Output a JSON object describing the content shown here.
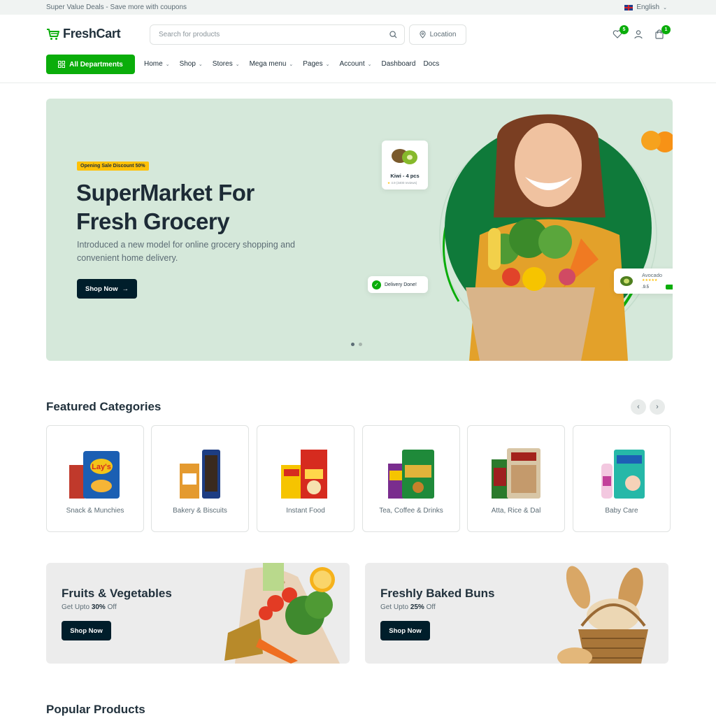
{
  "topbar": {
    "promo": "Super Value Deals - Save more with coupons",
    "language": "English"
  },
  "header": {
    "logo": "FreshCart",
    "search_placeholder": "Search for products",
    "location_label": "Location",
    "wishlist_count": "5",
    "cart_count": "1"
  },
  "nav": {
    "departments_label": "All Departments",
    "items": [
      {
        "label": "Home",
        "dropdown": true
      },
      {
        "label": "Shop",
        "dropdown": true
      },
      {
        "label": "Stores",
        "dropdown": true
      },
      {
        "label": "Mega menu",
        "dropdown": true
      },
      {
        "label": "Pages",
        "dropdown": true
      },
      {
        "label": "Account",
        "dropdown": true
      },
      {
        "label": "Dashboard",
        "dropdown": false
      },
      {
        "label": "Docs",
        "dropdown": false
      }
    ]
  },
  "hero": {
    "badge": "Opening Sale Discount 50%",
    "title": "SuperMarket For Fresh Grocery",
    "subtitle": "Introduced a new model for online grocery shopping and convenient home delivery.",
    "button": "Shop Now",
    "kiwi_card": {
      "title": "Kiwi - 4 pcs",
      "rating": "4.9",
      "reviews": "(3400 reviews)"
    },
    "delivery_card": "Delivery Done!",
    "avocado_card": {
      "title": "Avocado",
      "price": ".9.5"
    },
    "slides": 2,
    "active_slide": 1
  },
  "featured": {
    "title": "Featured Categories",
    "categories": [
      {
        "label": "Snack & Munchies"
      },
      {
        "label": "Bakery & Biscuits"
      },
      {
        "label": "Instant Food"
      },
      {
        "label": "Tea, Coffee & Drinks"
      },
      {
        "label": "Atta, Rice & Dal"
      },
      {
        "label": "Baby Care"
      }
    ]
  },
  "banners": [
    {
      "title": "Fruits & Vegetables",
      "prefix": "Get Upto ",
      "discount": "30%",
      "suffix": " Off",
      "button": "Shop Now"
    },
    {
      "title": "Freshly Baked Buns",
      "prefix": "Get Upto ",
      "discount": "25%",
      "suffix": " Off",
      "button": "Shop Now"
    }
  ],
  "popular": {
    "title": "Popular Products"
  },
  "colors": {
    "brand": "#0aad0a",
    "dark": "#001e2b",
    "hero_bg": "#d5e8da",
    "badge": "#ffc107"
  }
}
